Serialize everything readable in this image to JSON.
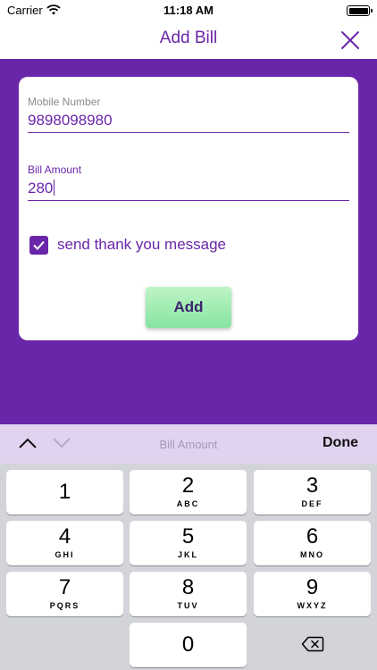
{
  "status_bar": {
    "carrier": "Carrier",
    "time": "11:18 AM"
  },
  "nav": {
    "title": "Add Bill"
  },
  "form": {
    "mobile": {
      "label": "Mobile Number",
      "value": "9898098980"
    },
    "amount": {
      "label": "Bill Amount",
      "value": "280"
    },
    "thank_you": {
      "label": "send thank you message",
      "checked": true
    },
    "add_label": "Add"
  },
  "accessory": {
    "field_label": "Bill Amount",
    "done_label": "Done"
  },
  "keypad": {
    "keys": [
      {
        "digit": "1",
        "letters": ""
      },
      {
        "digit": "2",
        "letters": "ABC"
      },
      {
        "digit": "3",
        "letters": "DEF"
      },
      {
        "digit": "4",
        "letters": "GHI"
      },
      {
        "digit": "5",
        "letters": "JKL"
      },
      {
        "digit": "6",
        "letters": "MNO"
      },
      {
        "digit": "7",
        "letters": "PQRS"
      },
      {
        "digit": "8",
        "letters": "TUV"
      },
      {
        "digit": "9",
        "letters": "WXYZ"
      },
      {
        "digit": "0",
        "letters": ""
      }
    ]
  },
  "colors": {
    "brand_purple": "#6a26a9",
    "button_green": "#86e4a0",
    "accessory_bg": "#e1d2ef"
  }
}
